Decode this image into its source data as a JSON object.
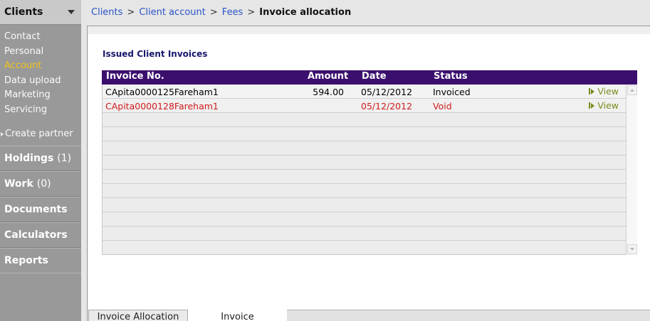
{
  "sidebar": {
    "header": "Clients",
    "sub_items": [
      "Contact",
      "Personal",
      "Account",
      "Data upload",
      "Marketing",
      "Servicing"
    ],
    "active_sub_item": "Account",
    "create_partner": "Create partner",
    "sections": [
      {
        "label": "Holdings",
        "count": "(1)"
      },
      {
        "label": "Work",
        "count": "(0)"
      },
      {
        "label": "Documents",
        "count": ""
      },
      {
        "label": "Calculators",
        "count": ""
      },
      {
        "label": "Reports",
        "count": ""
      }
    ]
  },
  "breadcrumb": {
    "items": [
      "Clients",
      "Client account",
      "Fees"
    ],
    "separator": ">",
    "current": "Invoice allocation"
  },
  "main": {
    "section_title": "Issued Client Invoices",
    "table": {
      "columns": [
        "Invoice No.",
        "Amount",
        "Date",
        "Status"
      ],
      "rows": [
        {
          "invoice_no": "CApita0000125Fareham1",
          "amount": "594.00",
          "date": "05/12/2012",
          "status": "Invoiced",
          "action": "View"
        },
        {
          "invoice_no": "CApita0000128Fareham1",
          "amount": "",
          "date": "05/12/2012",
          "status": "Void",
          "action": "View"
        }
      ],
      "empty_rows": 10
    },
    "tabs": [
      "Invoice Allocation",
      "Invoice"
    ],
    "active_tab": "Invoice"
  },
  "colors": {
    "table_header": "#3a0f6e",
    "link": "#2a55c8",
    "active_nav": "#f0c419",
    "void_text": "#d01b1b",
    "view_link": "#7b8a1d",
    "sidebar_bg": "#999999"
  },
  "icons": {
    "sidebar_header": "chevron-down-icon",
    "create_partner": "triangle-right-icon",
    "view": "play-arrow-icon",
    "scroll_up": "scroll-up-arrow-icon",
    "scroll_down": "scroll-down-arrow-icon"
  }
}
